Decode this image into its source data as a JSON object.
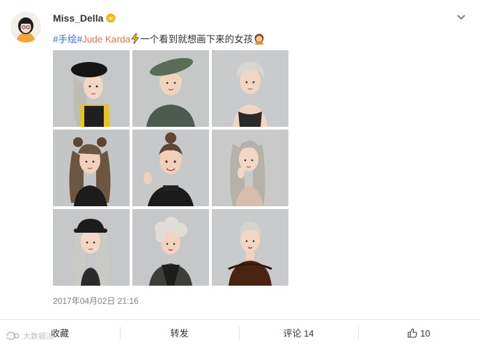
{
  "post": {
    "username": "Miss_Della",
    "hashtag": "#手绘#",
    "mention": "Jude Karda",
    "text_after": "一个看到就想画下来的女孩",
    "timestamp": "2017年04月02日 21:16"
  },
  "actions": {
    "collect_label": "收藏",
    "repost_label": "转发",
    "comment_label": "评论",
    "comment_count": "14",
    "like_count": "10"
  },
  "watermark": {
    "text": "大数据派"
  },
  "icons": {
    "crown": "crown-badge-icon",
    "chevron": "chevron-down-icon",
    "lightning": "lightning-emoji",
    "girl": "girl-emoji",
    "like": "thumbs-up-icon"
  },
  "gallery": {
    "illustrations": [
      {
        "hat": "black-beret",
        "hair": "#bdbdb4",
        "top": "#e9c31d"
      },
      {
        "hat": "olive-hat",
        "hair": "#c8c8c0",
        "top": "#4c5a50"
      },
      {
        "hat": "none",
        "hair": "#d7d6d0",
        "top": "#2a2a2a"
      },
      {
        "hat": "bun",
        "hair": "#6d5641",
        "top": "#1c1c1c"
      },
      {
        "hat": "bun",
        "hair": "#5e4737",
        "top": "#1a1a1a"
      },
      {
        "hat": "none",
        "hair": "#b4b2ab",
        "top": "#d8bcae"
      },
      {
        "hat": "black-cap",
        "hair": "#c9c9c5",
        "top": "#2b2b2b"
      },
      {
        "hat": "curly",
        "hair": "#e2dcd7",
        "top": "#3d3d3a"
      },
      {
        "hat": "pixie",
        "hair": "#d4d4cf",
        "top": "#4a2412"
      }
    ]
  }
}
